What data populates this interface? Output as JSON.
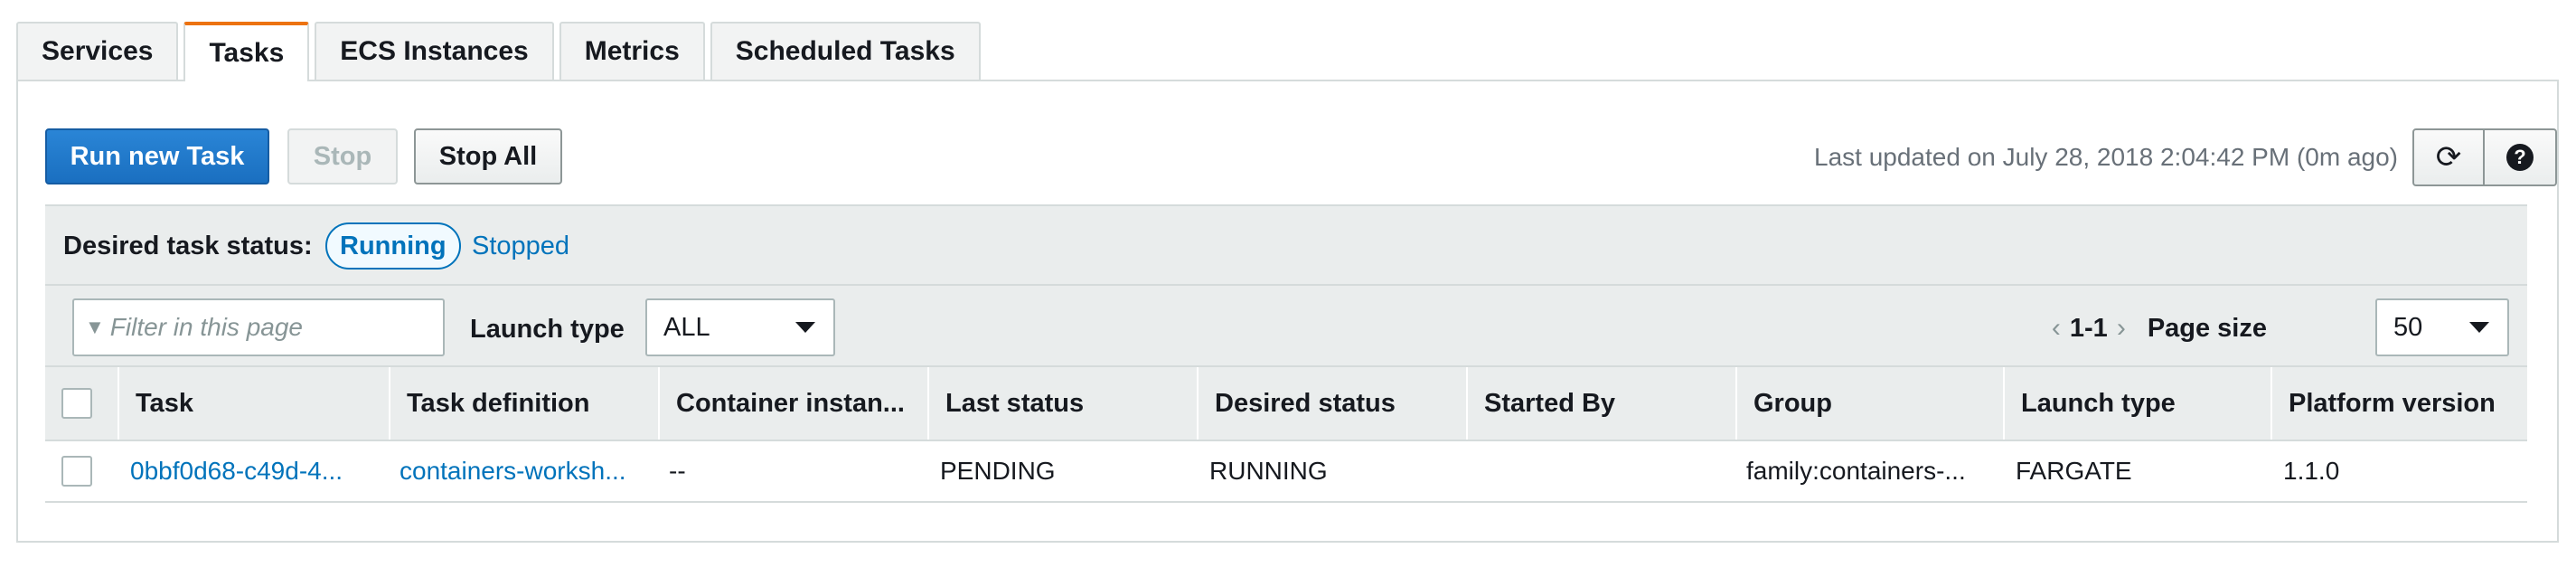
{
  "tabs": [
    {
      "label": "Services"
    },
    {
      "label": "Tasks"
    },
    {
      "label": "ECS Instances"
    },
    {
      "label": "Metrics"
    },
    {
      "label": "Scheduled Tasks"
    }
  ],
  "toolbar": {
    "run_label": "Run new Task",
    "stop_label": "Stop",
    "stop_all_label": "Stop All",
    "last_updated": "Last updated on July 28, 2018 2:04:42 PM (0m ago)",
    "refresh_icon": "⟳",
    "help_icon": "?"
  },
  "status_filter": {
    "label": "Desired task status:",
    "running": "Running",
    "stopped": "Stopped"
  },
  "filter": {
    "placeholder": "Filter in this page",
    "launch_type_label": "Launch type",
    "launch_type_value": "ALL",
    "pager_prev": "‹",
    "pager_range": "1-1",
    "pager_next": "›",
    "page_size_label": "Page size",
    "page_size_value": "50"
  },
  "table": {
    "columns": [
      "Task",
      "Task definition",
      "Container instan...",
      "Last status",
      "Desired status",
      "Started By",
      "Group",
      "Launch type",
      "Platform version"
    ],
    "rows": [
      {
        "task": "0bbf0d68-c49d-4...",
        "task_definition": "containers-worksh...",
        "container_instance": "--",
        "last_status": "PENDING",
        "desired_status": "RUNNING",
        "started_by": "",
        "group": "family:containers-...",
        "launch_type": "FARGATE",
        "platform_version": "1.1.0"
      }
    ]
  },
  "colors": {
    "accent": "#ec7211",
    "primary": "#1a6fc0",
    "link": "#0073bb"
  }
}
